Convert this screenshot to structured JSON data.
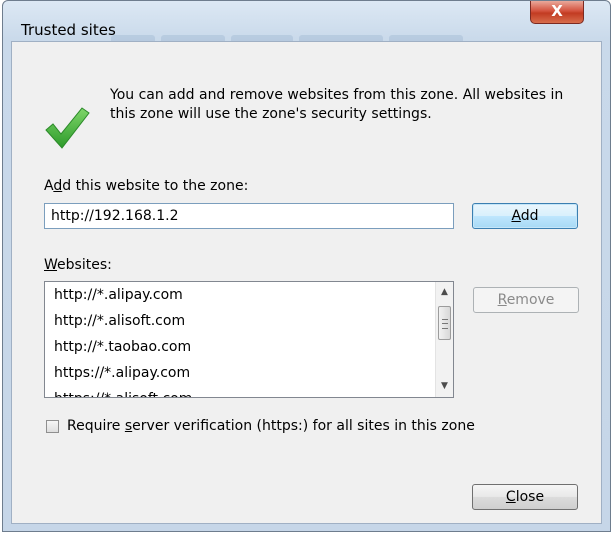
{
  "window": {
    "title": "Trusted sites",
    "close_glyph": "X"
  },
  "info_text": "You can add and remove websites from this zone. All websites in this zone will use the zone's security settings.",
  "add_section": {
    "label_prefix": "A",
    "label_mnemonic": "d",
    "label_suffix": "d this website to the zone:",
    "input_value": "http://192.168.1.2",
    "add_button": {
      "mnemonic": "A",
      "rest": "dd"
    }
  },
  "websites_section": {
    "label_mnemonic": "W",
    "label_rest": "ebsites:",
    "items": [
      "http://*.alipay.com",
      "http://*.alisoft.com",
      "http://*.taobao.com",
      "https://*.alipay.com",
      "https://*.alisoft.com"
    ],
    "remove_button": {
      "mnemonic": "R",
      "rest": "emove"
    }
  },
  "require_https": {
    "checked": false,
    "label_prefix": "Require ",
    "label_mnemonic": "s",
    "label_suffix": "erver verification (https:) for all sites in this zone"
  },
  "close_button": {
    "mnemonic": "C",
    "rest": "lose"
  },
  "icons": {
    "info_icon": "green-checkmark-icon",
    "scroll_up": "up-arrow-icon",
    "scroll_down": "down-arrow-icon"
  },
  "colors": {
    "check_green": "#3daa3a",
    "close_red": "#c23b22",
    "add_button_blue": "#bee6fd"
  }
}
